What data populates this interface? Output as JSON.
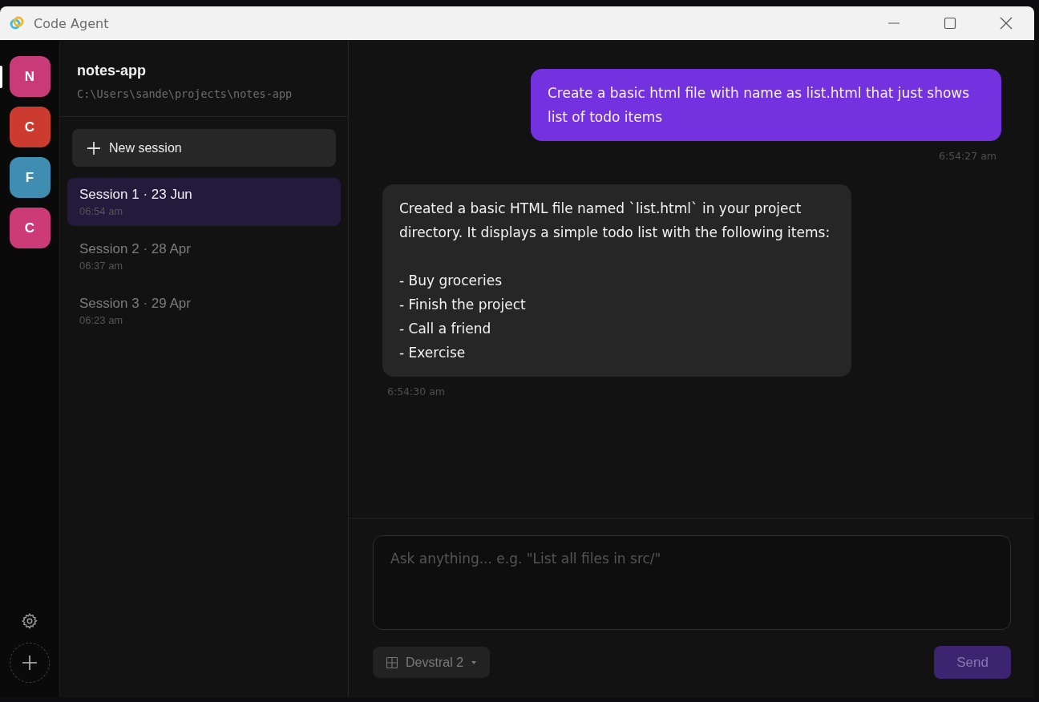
{
  "window": {
    "title": "Code Agent"
  },
  "projects": [
    {
      "letter": "N",
      "color": "#c93a78",
      "selected": true
    },
    {
      "letter": "C",
      "color": "#cc3b30",
      "selected": false
    },
    {
      "letter": "F",
      "color": "#3f8db0",
      "selected": false
    },
    {
      "letter": "C",
      "color": "#cc3a78",
      "selected": false
    }
  ],
  "project": {
    "name": "notes-app",
    "path": "C:\\Users\\sande\\projects\\notes-app"
  },
  "new_session": "New session",
  "sessions": [
    {
      "title": "Session 1 · 23 Jun",
      "time": "06:54 am",
      "selected": true
    },
    {
      "title": "Session 2 · 28 Apr",
      "time": "06:37 am",
      "selected": false
    },
    {
      "title": "Session 3 · 29 Apr",
      "time": "06:23 am",
      "selected": false
    }
  ],
  "messages": [
    {
      "kind": "user",
      "text": "Create a basic html file with name as list.html that just shows list of todo items",
      "time": "6:54:27 am"
    },
    {
      "kind": "assistant",
      "text": "Created a basic HTML file named `list.html` in your project directory. It displays a simple todo list with the following items:\n\n- Buy groceries\n- Finish the project\n- Call a friend\n- Exercise",
      "time": "6:54:30 am"
    }
  ],
  "composer": {
    "placeholder": "Ask anything... e.g. \"List all files in src/\"",
    "model": "Devstral 2",
    "send": "Send",
    "send_disabled": true
  }
}
